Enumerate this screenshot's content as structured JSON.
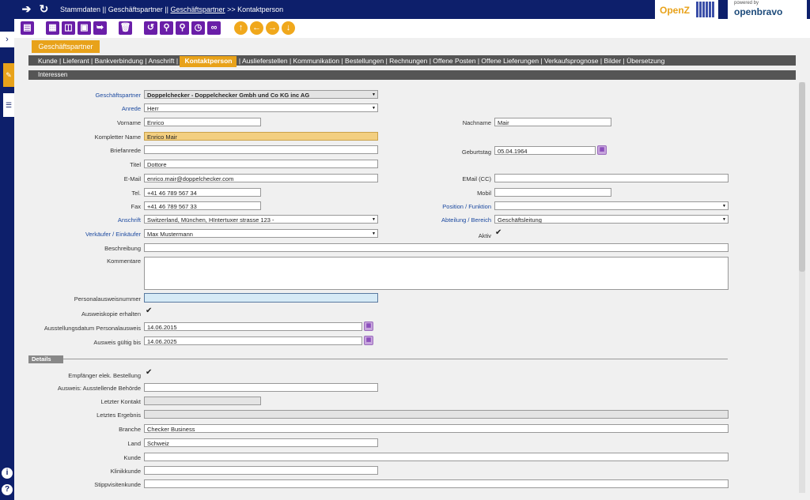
{
  "breadcrumb": {
    "root": "Stammdaten",
    "sep1": "||",
    "parent": "Geschäftspartner",
    "sep2": "||",
    "link": "Geschäftspartner",
    "arrow": ">>",
    "current": "Kontaktperson"
  },
  "logos": {
    "openz": "OpenZ",
    "powered_by": "powered by",
    "openbravo": "openbravo"
  },
  "tabs": {
    "parent_tab": "Geschäftspartner",
    "items_before": [
      "Kunde",
      "Lieferant",
      "Bankverbindung",
      "Anschrift"
    ],
    "selected": "Kontaktperson",
    "items_after": [
      "Auslieferstellen",
      "Kommunikation",
      "Bestellungen",
      "Rechnungen",
      "Offene Posten",
      "Offene Lieferungen",
      "Verkaufsprognose",
      "Bilder",
      "Übersetzung"
    ],
    "subtab": "Interessen"
  },
  "form": {
    "geschaeftspartner": {
      "label": "Geschäftspartner",
      "value": "Doppelchecker - Doppelchecker Gmbh und Co KG inc AG"
    },
    "anrede": {
      "label": "Anrede",
      "value": "Herr"
    },
    "vorname": {
      "label": "Vorname",
      "value": "Enrico"
    },
    "nachname": {
      "label": "Nachname",
      "value": "Mair"
    },
    "kompletter_name": {
      "label": "Kompletter Name",
      "value": "Enrico Mair"
    },
    "briefanrede": {
      "label": "Briefanrede",
      "value": ""
    },
    "geburtstag": {
      "label": "Geburtstag",
      "value": "05.04.1964"
    },
    "titel": {
      "label": "Titel",
      "value": "Dottore"
    },
    "email": {
      "label": "E-Mail",
      "value": "enrico.mair@doppelchecker.com"
    },
    "email_cc": {
      "label": "EMail (CC)",
      "value": ""
    },
    "tel": {
      "label": "Tel.",
      "value": "+41 46 789 567 34"
    },
    "mobil": {
      "label": "Mobil",
      "value": ""
    },
    "fax": {
      "label": "Fax",
      "value": "+41 46 789 567 33"
    },
    "position": {
      "label": "Position / Funktion",
      "value": ""
    },
    "anschrift": {
      "label": "Anschrift",
      "value": "Switzerland, München, HIntertuxer strasse 123 -"
    },
    "abteilung": {
      "label": "Abteilung / Bereich",
      "value": "Geschäftsleitung"
    },
    "verkaeufer": {
      "label": "Verkäufer / Einkäufer",
      "value": "Max Mustermann"
    },
    "aktiv": {
      "label": "Aktiv",
      "checked": true
    },
    "beschreibung": {
      "label": "Beschreibung",
      "value": ""
    },
    "kommentare": {
      "label": "Kommentare",
      "value": ""
    },
    "personalausweisnummer": {
      "label": "Personalausweisnummer",
      "value": ""
    },
    "ausweiskopie": {
      "label": "Ausweiskopie erhalten",
      "checked": true
    },
    "ausstellungsdatum": {
      "label": "Ausstellungsdatum Personalausweis",
      "value": "14.06.2015"
    },
    "ausweis_gueltig": {
      "label": "Ausweis gültig bis",
      "value": "14.06.2025"
    }
  },
  "details": {
    "header": "Details",
    "empfaenger": {
      "label": "Empfänger elek. Bestellung",
      "checked": true
    },
    "behoerde": {
      "label": "Ausweis: Ausstellende Behörde",
      "value": ""
    },
    "letzter_kontakt": {
      "label": "Letzter Kontakt",
      "value": ""
    },
    "letztes_ergebnis": {
      "label": "Letztes Ergebnis",
      "value": ""
    },
    "branche": {
      "label": "Branche",
      "value": "Checker Business"
    },
    "land": {
      "label": "Land",
      "value": "Schweiz"
    },
    "kunde": {
      "label": "Kunde",
      "value": ""
    },
    "klinikkunde": {
      "label": "Klinikkunde",
      "value": ""
    },
    "stippvisitenkunde": {
      "label": "Stippvisitenkunde",
      "value": ""
    }
  },
  "colors": {
    "navy": "#0d1f6b",
    "purple": "#6a1ea8",
    "gold": "#e8a21a"
  }
}
